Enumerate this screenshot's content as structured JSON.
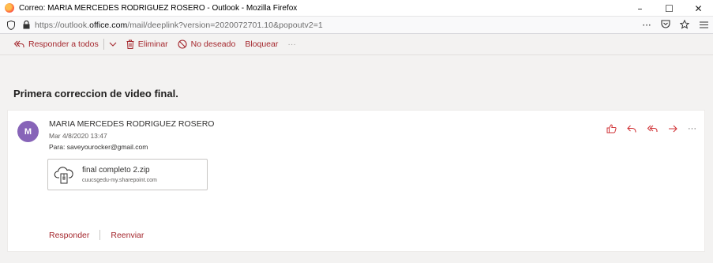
{
  "window": {
    "title": "Correo: MARIA MERCEDES RODRIGUEZ ROSERO - Outlook - Mozilla Firefox",
    "minimize": "–",
    "maximize": "☐",
    "close": "✕"
  },
  "urlbar": {
    "prefix": "https://outlook.",
    "domain": "office.com",
    "suffix": "/mail/deeplink?version=2020072701.10&popoutv2=1",
    "more": "···"
  },
  "toolbar": {
    "reply_all": "Responder a todos",
    "delete": "Eliminar",
    "junk": "No deseado",
    "block": "Bloquear",
    "more": "···"
  },
  "message": {
    "subject": "Primera correccion de video final.",
    "avatar_initial": "M",
    "avatar_color": "#8764b8",
    "sender": "MARIA MERCEDES RODRIGUEZ ROSERO",
    "date": "Mar 4/8/2020 13:47",
    "to_label": "Para:",
    "to_value": "saveyourocker@gmail.com",
    "more": "···"
  },
  "attachment": {
    "name": "final completo 2.zip",
    "source": "cuucsgedu-my.sharepoint.com"
  },
  "footer": {
    "reply": "Responder",
    "forward": "Reenviar"
  },
  "colors": {
    "accent": "#a4262c",
    "action_icon": "#d13438"
  }
}
